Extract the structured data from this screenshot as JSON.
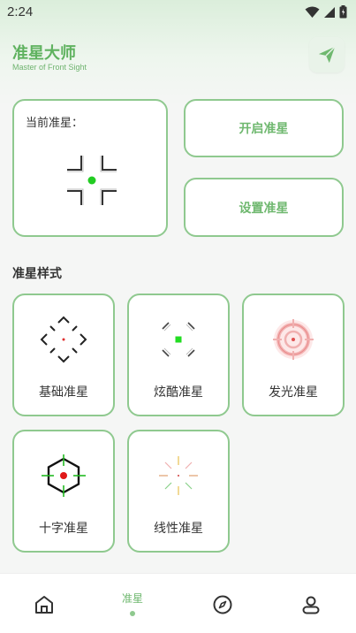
{
  "status_bar": {
    "time": "2:24"
  },
  "header": {
    "title": "准星大师",
    "subtitle": "Master of Front Sight",
    "action_icon": "paper-plane-icon"
  },
  "current": {
    "label": "当前准星：",
    "dot_color": "#22cc22"
  },
  "actions": {
    "open_label": "开启准星",
    "settings_label": "设置准星"
  },
  "styles_section": {
    "title": "准星样式",
    "items": [
      {
        "label": "基础准星",
        "icon": "basic-crosshair-icon"
      },
      {
        "label": "炫酷准星",
        "icon": "cool-crosshair-icon"
      },
      {
        "label": "发光准星",
        "icon": "glow-crosshair-icon"
      },
      {
        "label": "十字准星",
        "icon": "hex-cross-crosshair-icon"
      },
      {
        "label": "线性准星",
        "icon": "linear-crosshair-icon"
      }
    ]
  },
  "bottom_nav": {
    "items": [
      {
        "icon": "home-icon"
      },
      {
        "label": "准星",
        "active": true
      },
      {
        "icon": "compass-icon"
      },
      {
        "icon": "profile-icon"
      }
    ]
  },
  "colors": {
    "accent": "#8fc98f",
    "accent_text": "#6fb86f",
    "title": "#5fb25f"
  }
}
